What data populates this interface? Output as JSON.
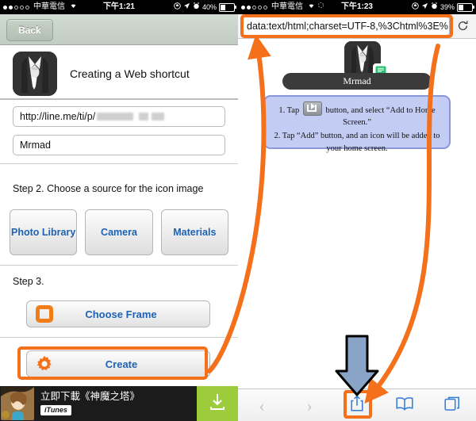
{
  "meta": {
    "accent_orange": "#f4701b",
    "link_blue": "#1d62b5",
    "instr_bg": "#c3cdf4"
  },
  "left": {
    "status": {
      "carrier": "中華電信",
      "wifi": "▾",
      "time": "下午1:21",
      "battery_pct": "40%"
    },
    "nav": {
      "back_label": "Back"
    },
    "app": {
      "title": "Creating a Web shortcut",
      "icon": "suit-tie-icon"
    },
    "fields": {
      "url_value": "http://line.me/ti/p/",
      "url_redacted": true,
      "name_value": "Mrmad"
    },
    "step2": {
      "label": "Step 2. Choose a source for the icon image",
      "buttons": [
        "Photo Library",
        "Camera",
        "Materials"
      ]
    },
    "step3": {
      "label": "Step 3.",
      "choose_frame": "Choose Frame",
      "create": "Create"
    },
    "ad": {
      "text": "立即下載《神魔之塔》",
      "badge": "iTunes",
      "download_icon": "download-icon"
    }
  },
  "right": {
    "status": {
      "carrier": "中華電信",
      "wifi": "▾",
      "time": "下午1:23",
      "battery_pct": "39%"
    },
    "url": {
      "value": "data:text/html;charset=UTF-8,%3Chtml%3E%",
      "reload_icon": "reload-icon"
    },
    "preview": {
      "icon": "suit-tie-icon",
      "badge_icon": "chat-bubble-icon",
      "name": "Mrmad"
    },
    "instructions": {
      "line1_a": "1. Tap",
      "line1_b": "button, and select “Add to Home Screen.”",
      "line2": "2. Tap “Add” button, and an icon will be added to your home screen."
    },
    "toolbar": {
      "back": "‹",
      "forward": "›",
      "share": "share-icon",
      "bookmarks": "book-icon",
      "tabs": "tabs-icon"
    }
  }
}
